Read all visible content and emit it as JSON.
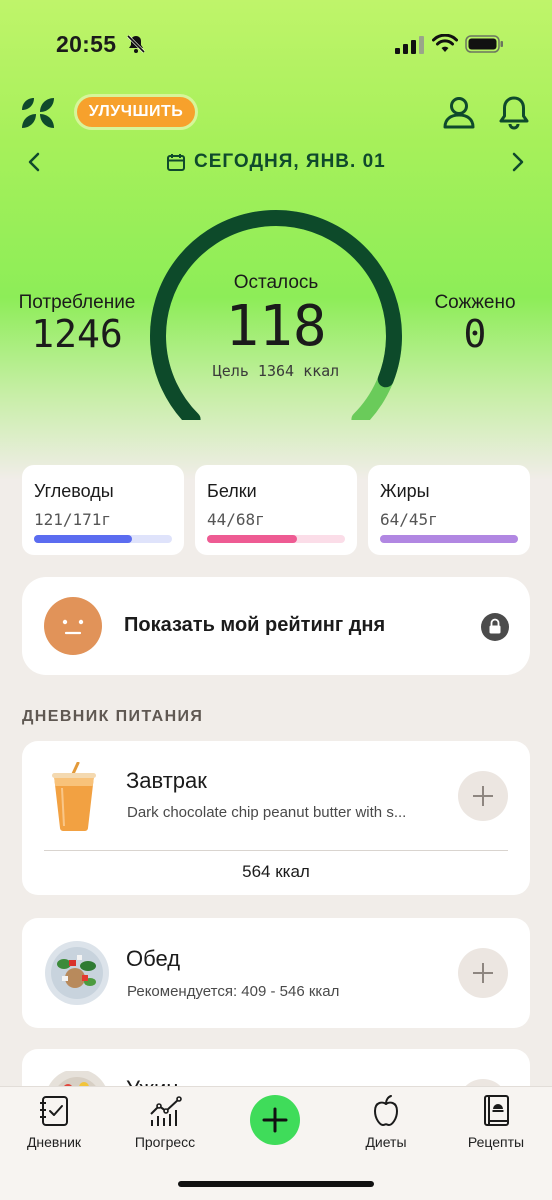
{
  "status_bar": {
    "time": "20:55"
  },
  "header": {
    "upgrade_label": "УЛУЧШИТЬ",
    "date_label": "СЕГОДНЯ, ЯНВ. 01"
  },
  "summary": {
    "consumed_label": "Потребление",
    "consumed_value": "1246",
    "remaining_label": "Осталось",
    "remaining_value": "118",
    "goal_label": "Цель 1364 ккал",
    "burned_label": "Сожжено",
    "burned_value": "0",
    "progress_fraction": 0.913
  },
  "macros": [
    {
      "name": "Углеводы",
      "value": "121/171г",
      "fraction": 0.71,
      "color": "#5b6cf0",
      "track": "#dfe3fb"
    },
    {
      "name": "Белки",
      "value": "44/68г",
      "fraction": 0.65,
      "color": "#ee5b93",
      "track": "#fbdde8"
    },
    {
      "name": "Жиры",
      "value": "64/45г",
      "fraction": 1.0,
      "color": "#b187e2",
      "track": "#ece1f8"
    }
  ],
  "rating": {
    "label": "Показать мой рейтинг дня"
  },
  "diary": {
    "title": "ДНЕВНИК ПИТАНИЯ",
    "meals": [
      {
        "name": "Завтрак",
        "subtitle": "Dark chocolate chip peanut butter with s...",
        "total": "564 ккал"
      },
      {
        "name": "Обед",
        "subtitle": "Рекомендуется: 409 - 546 ккал"
      },
      {
        "name": "Ужин"
      }
    ]
  },
  "tabs": [
    {
      "label": "Дневник",
      "icon": "diary-icon"
    },
    {
      "label": "Прогресс",
      "icon": "progress-chart-icon"
    },
    {
      "label": "",
      "icon": "plus-icon"
    },
    {
      "label": "Диеты",
      "icon": "apple-icon"
    },
    {
      "label": "Рецепты",
      "icon": "recipe-book-icon"
    }
  ],
  "colors": {
    "accent_green": "#0f4a2c",
    "upgrade_orange": "#f7a12c",
    "fab_green": "#3fdc5a"
  }
}
